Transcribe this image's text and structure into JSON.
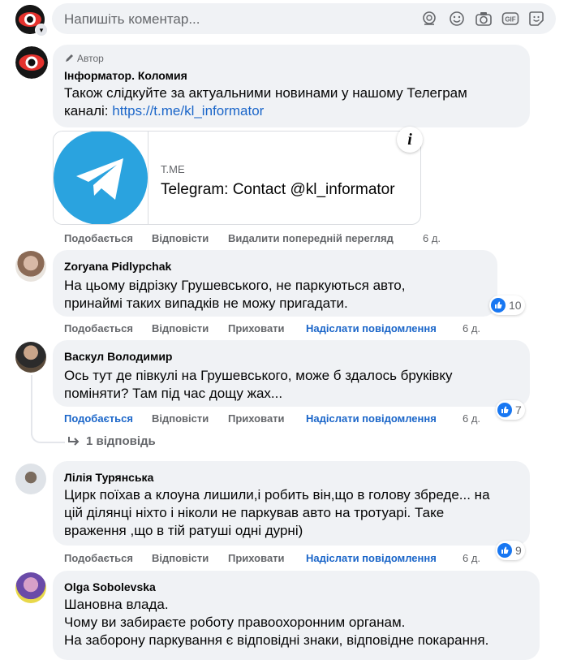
{
  "composer": {
    "placeholder": "Напишіть коментар..."
  },
  "comments": [
    {
      "badge": "Автор",
      "author": "Інформатор. Коломия",
      "text_line1": "Також слідкуйте за актуальними новинами у нашому Телеграм",
      "text_line2_prefix": "каналі: ",
      "link": "https://t.me/kl_informator",
      "preview": {
        "domain": "T.ME",
        "title": "Telegram: Contact @kl_informator",
        "info": "i"
      },
      "actions": {
        "like": "Подобається",
        "reply": "Відповісти",
        "remove_preview": "Видалити попередній перегляд",
        "time": "6 д."
      }
    },
    {
      "author": "Zoryana Pidlypchak",
      "lines": [
        "На цьому відрізку Грушевського, не паркуються авто,",
        "принаймі таких випадків не можу пригадати."
      ],
      "reactions": "10",
      "actions": {
        "like": "Подобається",
        "reply": "Відповісти",
        "hide": "Приховати",
        "message": "Надіслати повідомлення",
        "time": "6 д."
      }
    },
    {
      "author": "Васкул Володимир",
      "lines": [
        "Ось тут де півкулі на Грушевського, може б здалось бруківку",
        "поміняти? Там під час дощу жах..."
      ],
      "reactions": "7",
      "actions": {
        "like": "Подобається",
        "reply": "Відповісти",
        "hide": "Приховати",
        "message": "Надіслати повідомлення",
        "time": "6 д."
      },
      "replies": "1 відповідь"
    },
    {
      "author": "Лілія Турянська",
      "lines": [
        "Цирк поїхав а клоуна лишили,і робить він,що в голову збреде... на",
        "цій ділянці ніхто і ніколи не паркував авто на тротуарі. Таке",
        "враження ,що в тій ратуші одні дурні)"
      ],
      "reactions": "9",
      "actions": {
        "like": "Подобається",
        "reply": "Відповісти",
        "hide": "Приховати",
        "message": "Надіслати повідомлення",
        "time": "6 д."
      }
    },
    {
      "author": "Olga Sobolevska",
      "lines": [
        "Шановна влада.",
        "Чому ви забираєте роботу правоохоронним органам.",
        "На заборону паркування є відповідні знаки, відповідне покарання."
      ]
    }
  ],
  "colors": {
    "link": "#1b66c9",
    "like_blue": "#1877f2",
    "bubble": "#f0f2f5",
    "telegram": "#2aa3df"
  }
}
